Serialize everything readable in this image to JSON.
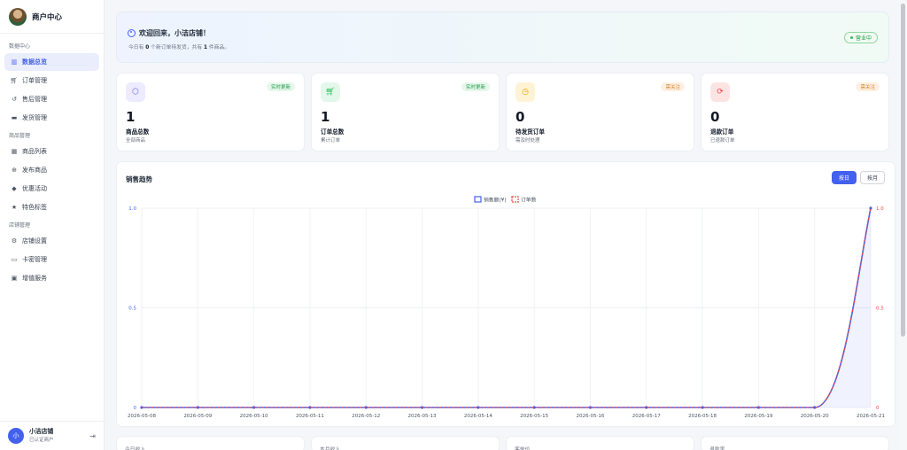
{
  "sidebar": {
    "brand": "商户中心",
    "groups": [
      {
        "label": "数据中心",
        "items": [
          {
            "label": "数据总览",
            "icon": "bar-chart-icon",
            "active": true
          },
          {
            "label": "订单管理",
            "icon": "cart-icon"
          },
          {
            "label": "售后管理",
            "icon": "undo-icon"
          },
          {
            "label": "发货管理",
            "icon": "truck-icon"
          }
        ]
      },
      {
        "label": "商品管理",
        "items": [
          {
            "label": "商品列表",
            "icon": "grid-icon"
          },
          {
            "label": "发布商品",
            "icon": "plus-circle-icon"
          },
          {
            "label": "优惠活动",
            "icon": "tag-icon"
          },
          {
            "label": "特色标签",
            "icon": "star-icon"
          }
        ]
      },
      {
        "label": "店铺管理",
        "items": [
          {
            "label": "店铺设置",
            "icon": "gear-icon"
          },
          {
            "label": "卡密管理",
            "icon": "card-icon"
          },
          {
            "label": "增值服务",
            "icon": "gift-icon"
          }
        ]
      }
    ],
    "user": {
      "avatar": "小",
      "name": "小洁店铺",
      "role": "已认证商户"
    }
  },
  "welcome": {
    "title": "欢迎回来，小洁店铺！",
    "sub_prefix": "今日有",
    "pending": "0",
    "sub_mid": "个新订单待发货，共有",
    "products": "1",
    "sub_suffix": "件商品。",
    "status": "营业中"
  },
  "stats": [
    {
      "value": "1",
      "title": "商品总数",
      "sub": "全部商品",
      "badge": "实时更新",
      "icon": "cube-icon",
      "color": "#6c63ff",
      "bg": "#ecebff",
      "badge_color": "#1f9d48",
      "badge_bg": "#e6f7ec"
    },
    {
      "value": "1",
      "title": "订单总数",
      "sub": "累计订单",
      "badge": "实时更新",
      "icon": "cart-icon",
      "color": "#2fbf5a",
      "bg": "#e3f7ea",
      "badge_color": "#1f9d48",
      "badge_bg": "#e6f7ec"
    },
    {
      "value": "0",
      "title": "待发货订单",
      "sub": "需及时处理",
      "badge": "需关注",
      "icon": "clock-icon",
      "color": "#f0a500",
      "bg": "#fff3d6",
      "badge_color": "#d9822b",
      "badge_bg": "#fdf0e2"
    },
    {
      "value": "0",
      "title": "退款订单",
      "sub": "已退款订单",
      "badge": "需关注",
      "icon": "refresh-icon",
      "color": "#ef4444",
      "bg": "#fde4e4",
      "badge_color": "#d9822b",
      "badge_bg": "#fdf0e2"
    }
  ],
  "chart_section": {
    "title": "销售趋势",
    "buttons": [
      {
        "label": "按日",
        "active": true
      },
      {
        "label": "按月",
        "active": false
      }
    ]
  },
  "chart_data": {
    "type": "line",
    "categories": [
      "2026-05-08",
      "2026-05-09",
      "2026-05-10",
      "2026-05-11",
      "2026-05-12",
      "2026-05-13",
      "2026-05-14",
      "2026-05-15",
      "2026-05-16",
      "2026-05-17",
      "2026-05-18",
      "2026-05-19",
      "2026-05-20",
      "2026-05-21"
    ],
    "series": [
      {
        "name": "销售额(¥)",
        "values": [
          0,
          0,
          0,
          0,
          0,
          0,
          0,
          0,
          0,
          0,
          0,
          0,
          0,
          1
        ],
        "color": "#4361ee",
        "axis": "left",
        "fill": true
      },
      {
        "name": "订单数",
        "values": [
          0,
          0,
          0,
          0,
          0,
          0,
          0,
          0,
          0,
          0,
          0,
          0,
          0,
          1
        ],
        "color": "#ef4444",
        "axis": "right",
        "dashed": true
      }
    ],
    "ylim_left": [
      0,
      1
    ],
    "ylim_right": [
      0,
      1
    ],
    "yticks": [
      "0",
      "0.5",
      "1.0"
    ],
    "grid": true,
    "legend": "top-center"
  },
  "bottom_cards": [
    "今日收入",
    "本月收入",
    "客单价",
    "退款率"
  ]
}
